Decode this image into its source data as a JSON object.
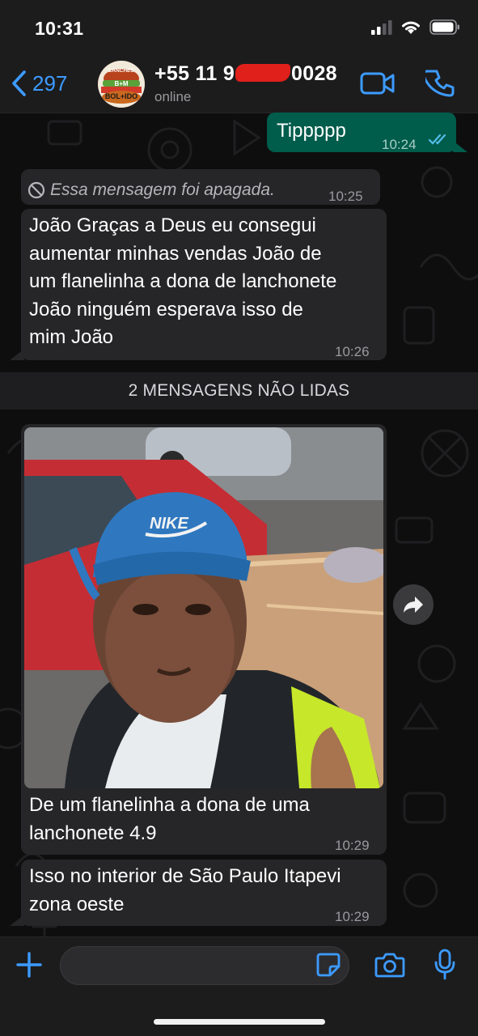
{
  "status_bar": {
    "time": "10:31"
  },
  "header": {
    "back_count": "297",
    "contact_name_start": "+55 11 9",
    "contact_name_end": "0028",
    "contact_status": "online",
    "avatar_text_top": "LANCHES",
    "avatar_text_mid": "B+M",
    "avatar_text_bottom": "BOL+IDO"
  },
  "messages": [
    {
      "direction": "outgoing",
      "text": "Tippppp",
      "time": "10:24",
      "status": "read"
    },
    {
      "direction": "incoming",
      "text": "Essa mensagem foi apagada.",
      "time": "10:25",
      "deleted": true
    },
    {
      "direction": "incoming",
      "lines": [
        "João Graças a Deus eu consegui",
        "aumentar minhas vendas João de",
        "um flanelinha a dona de lanchonete",
        "João ninguém esperava isso de",
        "mim João"
      ],
      "time": "10:26"
    },
    {
      "direction": "incoming",
      "type": "photo",
      "photo_cap_text": "NIKE",
      "lines": [
        "De um flanelinha a dona de uma",
        "lanchonete 4.9"
      ],
      "time": "10:29"
    },
    {
      "direction": "incoming",
      "lines": [
        "Isso no interior de São Paulo Itapevi",
        "zona oeste"
      ],
      "time": "10:29"
    }
  ],
  "unread_banner": "2 MENSAGENS NÃO LIDAS",
  "icons": {
    "back": "chevron-left-icon",
    "video": "video-camera-icon",
    "call": "phone-icon",
    "deleted": "blocked-icon",
    "read_receipt": "double-check-icon",
    "forward": "forward-arrow-icon",
    "plus": "plus-icon",
    "sticker": "sticker-icon",
    "camera": "camera-icon",
    "mic": "microphone-icon"
  },
  "colors": {
    "accent": "#3d9bff",
    "outgoing_bubble": "#005c4b",
    "incoming_bubble": "#262628",
    "read_tick": "#53bdeb"
  }
}
